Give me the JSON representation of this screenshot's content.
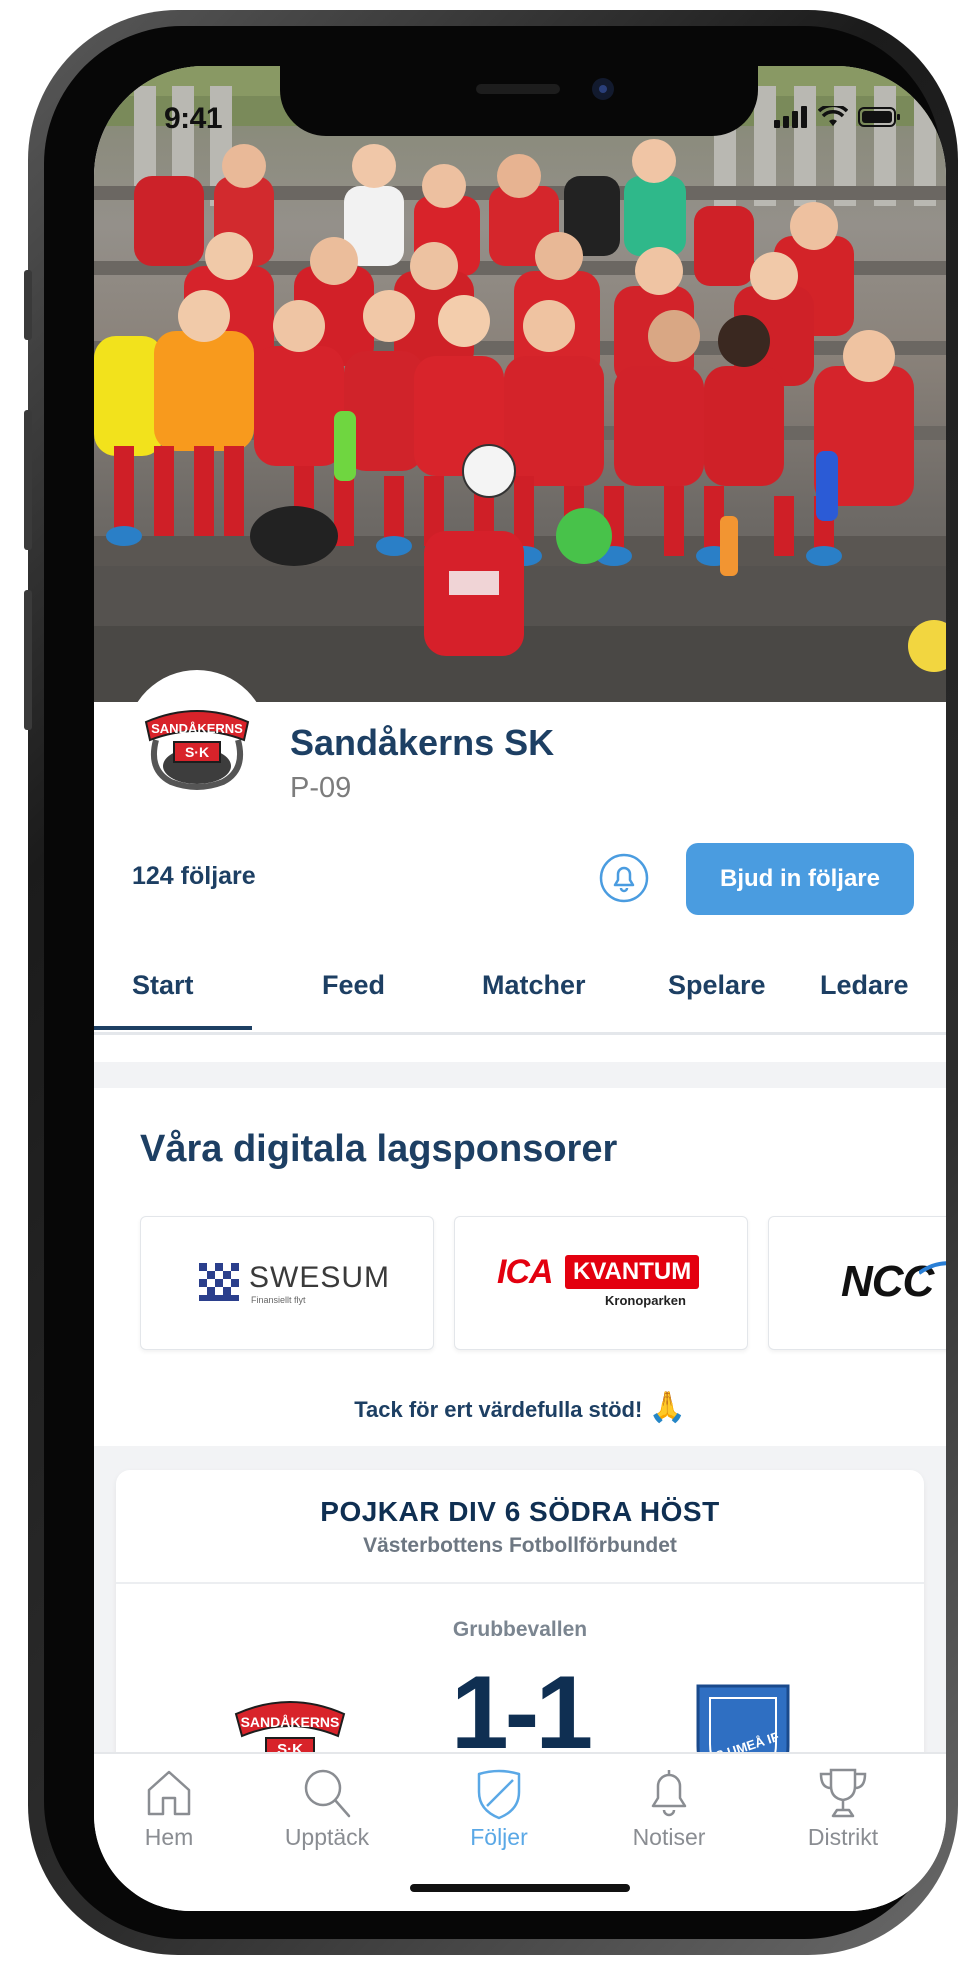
{
  "status_bar": {
    "time": "9:41"
  },
  "profile": {
    "club_name": "Sandåkerns SK",
    "team_name": "P-09",
    "followers": "124 följare",
    "invite_button": "Bjud in följare",
    "logo_text_top": "SANDÅKERNS",
    "logo_text_bottom": "S·K"
  },
  "tabs": [
    {
      "label": "Start",
      "active": true
    },
    {
      "label": "Feed"
    },
    {
      "label": "Matcher"
    },
    {
      "label": "Spelare"
    },
    {
      "label": "Ledare"
    }
  ],
  "sponsors": {
    "title": "Våra digitala lagsponsorer",
    "items": [
      {
        "name": "SWESUM",
        "tagline": "Finansiellt flyt"
      },
      {
        "name_left": "ICA",
        "name_right": "KVANTUM",
        "sub": "Kronoparken"
      },
      {
        "name": "NCC"
      }
    ],
    "thanks": "Tack för ert värdefulla stöd!",
    "thanks_emoji": "🙏"
  },
  "match": {
    "title": "POJKAR DIV 6 SÖDRA HÖST",
    "organizer": "Västerbottens Fotbollförbundet",
    "venue": "Grubbevallen",
    "score": "1-1",
    "away_logo_text": "TS UMEÅ IF"
  },
  "bottom_nav": [
    {
      "label": "Hem",
      "icon": "home-icon"
    },
    {
      "label": "Upptäck",
      "icon": "search-icon"
    },
    {
      "label": "Följer",
      "icon": "shield-icon",
      "active": true
    },
    {
      "label": "Notiser",
      "icon": "bell-icon"
    },
    {
      "label": "Distrikt",
      "icon": "trophy-icon"
    }
  ],
  "colors": {
    "primary": "#1d3f63",
    "accent": "#4a9ce0",
    "active_nav": "#5aa8e6",
    "jersey_red": "#d8232a"
  }
}
